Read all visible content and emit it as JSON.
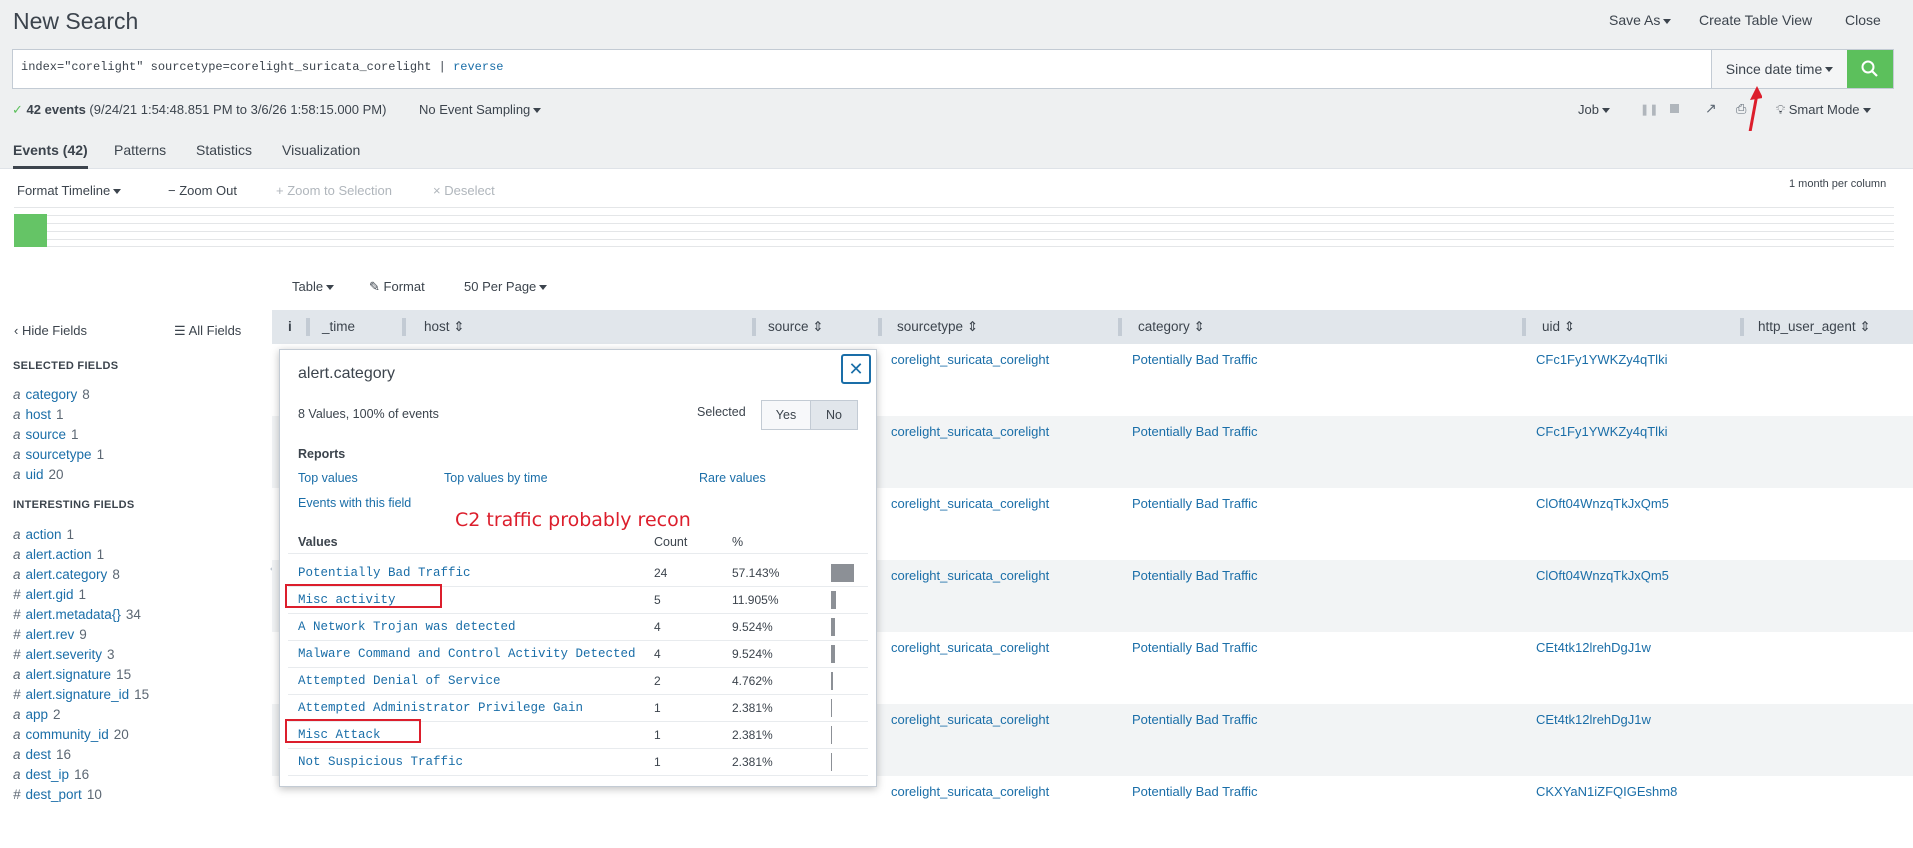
{
  "header": {
    "title": "New Search",
    "save_as": "Save As",
    "create_table_view": "Create Table View",
    "close": "Close"
  },
  "search": {
    "query_main": "index=\"corelight\" sourcetype=corelight_suricata_corelight | ",
    "query_cmd": "reverse",
    "time_picker": "Since date time"
  },
  "status": {
    "events_count": "42 events",
    "range": "(9/24/21 1:54:48.851 PM to 3/6/26 1:58:15.000 PM)",
    "sampling": "No Event Sampling",
    "job": "Job",
    "mode": "Smart Mode"
  },
  "tabs": [
    "Events (42)",
    "Patterns",
    "Statistics",
    "Visualization"
  ],
  "timeline": {
    "format": "Format Timeline",
    "zoom_out": "Zoom Out",
    "zoom_selection": "+ Zoom to Selection",
    "deselect": "Deselect",
    "scale": "1 month per column"
  },
  "results_toolbar": {
    "table": "Table",
    "format": "Format",
    "per_page": "50 Per Page"
  },
  "fields_panel": {
    "hide": "Hide Fields",
    "all": "All Fields",
    "selected_title": "SELECTED FIELDS",
    "interesting_title": "INTERESTING FIELDS",
    "selected": [
      {
        "type": "a",
        "name": "category",
        "count": "8"
      },
      {
        "type": "a",
        "name": "host",
        "count": "1"
      },
      {
        "type": "a",
        "name": "source",
        "count": "1"
      },
      {
        "type": "a",
        "name": "sourcetype",
        "count": "1"
      },
      {
        "type": "a",
        "name": "uid",
        "count": "20"
      }
    ],
    "interesting": [
      {
        "type": "a",
        "name": "action",
        "count": "1"
      },
      {
        "type": "a",
        "name": "alert.action",
        "count": "1"
      },
      {
        "type": "a",
        "name": "alert.category",
        "count": "8"
      },
      {
        "type": "#",
        "name": "alert.gid",
        "count": "1"
      },
      {
        "type": "#",
        "name": "alert.metadata{}",
        "count": "34"
      },
      {
        "type": "#",
        "name": "alert.rev",
        "count": "9"
      },
      {
        "type": "#",
        "name": "alert.severity",
        "count": "3"
      },
      {
        "type": "a",
        "name": "alert.signature",
        "count": "15"
      },
      {
        "type": "#",
        "name": "alert.signature_id",
        "count": "15"
      },
      {
        "type": "a",
        "name": "app",
        "count": "2"
      },
      {
        "type": "a",
        "name": "community_id",
        "count": "20"
      },
      {
        "type": "a",
        "name": "dest",
        "count": "16"
      },
      {
        "type": "a",
        "name": "dest_ip",
        "count": "16"
      },
      {
        "type": "#",
        "name": "dest_port",
        "count": "10"
      }
    ]
  },
  "table": {
    "columns": [
      "i",
      "_time",
      "host",
      "source",
      "sourcetype",
      "category",
      "uid",
      "http_user_agent"
    ],
    "rows": [
      {
        "sourcetype": "corelight_suricata_corelight",
        "category": "Potentially Bad Traffic",
        "uid": "CFc1Fy1YWKZy4qTlki"
      },
      {
        "sourcetype": "corelight_suricata_corelight",
        "category": "Potentially Bad Traffic",
        "uid": "CFc1Fy1YWKZy4qTlki"
      },
      {
        "sourcetype": "corelight_suricata_corelight",
        "category": "Potentially Bad Traffic",
        "uid": "ClOft04WnzqTkJxQm5"
      },
      {
        "sourcetype": "corelight_suricata_corelight",
        "category": "Potentially Bad Traffic",
        "uid": "ClOft04WnzqTkJxQm5"
      },
      {
        "sourcetype": "corelight_suricata_corelight",
        "category": "Potentially Bad Traffic",
        "uid": "CEt4tk12lrehDgJ1w"
      },
      {
        "sourcetype": "corelight_suricata_corelight",
        "category": "Potentially Bad Traffic",
        "uid": "CEt4tk12lrehDgJ1w"
      },
      {
        "sourcetype": "corelight_suricata_corelight",
        "category": "Potentially Bad Traffic",
        "uid": "CKXYaN1iZFQIGEshm8"
      }
    ]
  },
  "popup": {
    "title": "alert.category",
    "summary": "8 Values, 100% of events",
    "selected_label": "Selected",
    "yes": "Yes",
    "no": "No",
    "reports_title": "Reports",
    "top_values": "Top values",
    "top_values_time": "Top values by time",
    "rare_values": "Rare values",
    "events_with_field": "Events with this field",
    "annotation": "C2 traffic probably recon",
    "col_values": "Values",
    "col_count": "Count",
    "col_pct": "%",
    "values": [
      {
        "value": "Potentially Bad Traffic",
        "count": "24",
        "pct": "57.143%",
        "frac": 0.57143
      },
      {
        "value": "Misc activity",
        "count": "5",
        "pct": "11.905%",
        "frac": 0.11905
      },
      {
        "value": "A Network Trojan was detected",
        "count": "4",
        "pct": "9.524%",
        "frac": 0.09524
      },
      {
        "value": "Malware Command and Control Activity Detected",
        "count": "4",
        "pct": "9.524%",
        "frac": 0.09524
      },
      {
        "value": "Attempted Denial of Service",
        "count": "2",
        "pct": "4.762%",
        "frac": 0.04762
      },
      {
        "value": "Attempted Administrator Privilege Gain",
        "count": "1",
        "pct": "2.381%",
        "frac": 0.02381
      },
      {
        "value": "Misc Attack",
        "count": "1",
        "pct": "2.381%",
        "frac": 0.02381
      },
      {
        "value": "Not Suspicious Traffic",
        "count": "1",
        "pct": "2.381%",
        "frac": 0.02381
      }
    ]
  },
  "colors": {
    "link": "#1a6ea8",
    "search_button": "#5cc05c",
    "annotation_red": "#dc1e2c",
    "timeline_bar": "#65c466"
  }
}
